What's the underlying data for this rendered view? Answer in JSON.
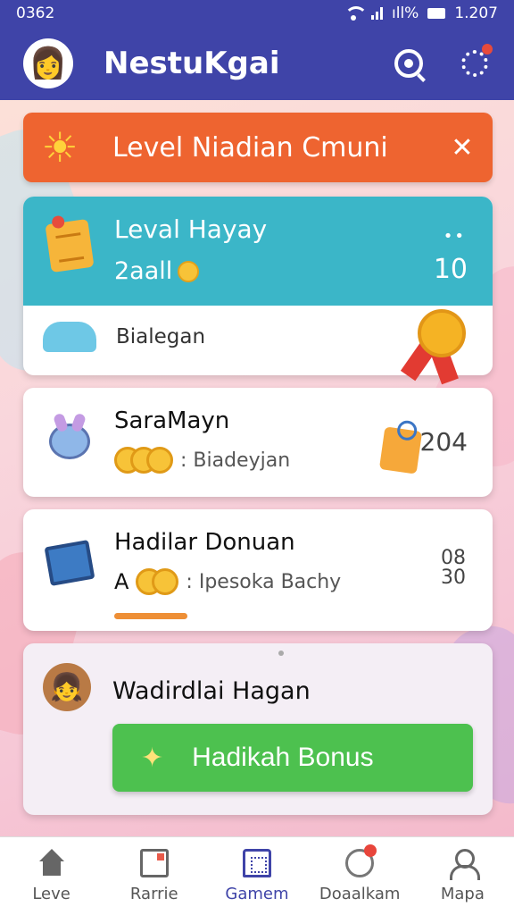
{
  "status_bar": {
    "time_left": "0362",
    "signal_text": "ıll%",
    "time_right": "1.207"
  },
  "header": {
    "title": "NestuKgai",
    "avatar": "👩"
  },
  "banner": {
    "title": "Level Niadian Cmuni",
    "sun": "☀",
    "close": "✕"
  },
  "level_card": {
    "title": "Leval Hayay",
    "subtitle": "2aall",
    "value": "10",
    "more": "••",
    "bottom_label": "Bialegan"
  },
  "list": [
    {
      "title": "SaraMayn",
      "subtitle": ": Biadeyjan",
      "value": "204"
    },
    {
      "title": "Hadilar Donuan",
      "prefix": "A",
      "subtitle": ": Ipesoka Bachy",
      "value_top": "08",
      "value_bottom": "30",
      "progress": 1.0
    }
  ],
  "bonus": {
    "title": "Wadirdlai Hagan",
    "button": "Hadikah Bonus",
    "sparkle": "✦"
  },
  "nav": [
    {
      "label": "Leve"
    },
    {
      "label": "Rarrie"
    },
    {
      "label": "Gamem"
    },
    {
      "label": "Doaalkam"
    },
    {
      "label": "Mapa"
    }
  ],
  "colors": {
    "primary": "#3f44a8",
    "banner": "#ee6430",
    "level": "#3bb6c8",
    "bonus_button": "#4dc14f"
  }
}
